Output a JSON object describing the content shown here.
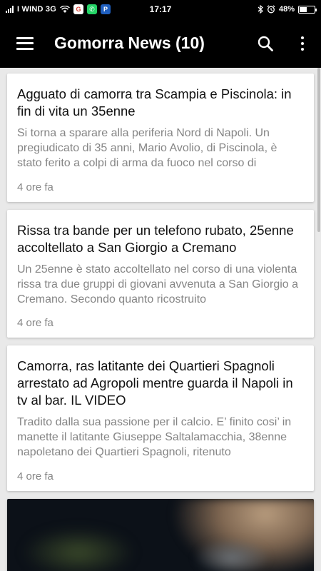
{
  "status_bar": {
    "carrier": "I WIND 3G",
    "time": "17:17",
    "battery": "48%",
    "battery_level": 0.48,
    "icons": [
      "signal-icon",
      "wifi-icon",
      "google-app-icon",
      "whatsapp-app-icon",
      "paypal-app-icon",
      "bluetooth-icon",
      "alarm-icon",
      "battery-icon"
    ]
  },
  "app_bar": {
    "title": "Gomorra News (10)",
    "icons": [
      "menu-icon",
      "search-icon",
      "more-vert-icon"
    ]
  },
  "articles": [
    {
      "title": "Agguato di camorra tra Scampia e Piscinola: in fin di vita un 35enne",
      "summary": "Si torna a sparare alla periferia Nord di Napoli. Un pregiudicato di 35 anni, Mario Avolio, di Piscinola, è stato ferito a colpi di arma da fuoco nel corso di",
      "time": "4 ore fa"
    },
    {
      "title": "Rissa tra bande per un telefono rubato, 25enne accoltellato a San Giorgio a Cremano",
      "summary": "Un 25enne è stato accoltellato nel corso di una violenta rissa tra due gruppi di giovani avvenuta a San Giorgio a Cremano. Secondo quanto ricostruito",
      "time": "4 ore fa"
    },
    {
      "title": "Camorra, ras latitante dei Quartieri Spagnoli arrestato ad Agropoli mentre guarda il Napoli in tv al bar. IL VIDEO",
      "summary": "Tradito dalla sua passione per il calcio. E’ finito cosi’ in manette il latitante Giuseppe Saltalamacchia, 38enne napoletano dei Quartieri Spagnoli, ritenuto",
      "time": "4 ore fa"
    }
  ],
  "colors": {
    "app_bar": "#000000",
    "background": "#e9e9e9",
    "card": "#ffffff",
    "title_text": "#111111",
    "secondary_text": "#858585"
  }
}
